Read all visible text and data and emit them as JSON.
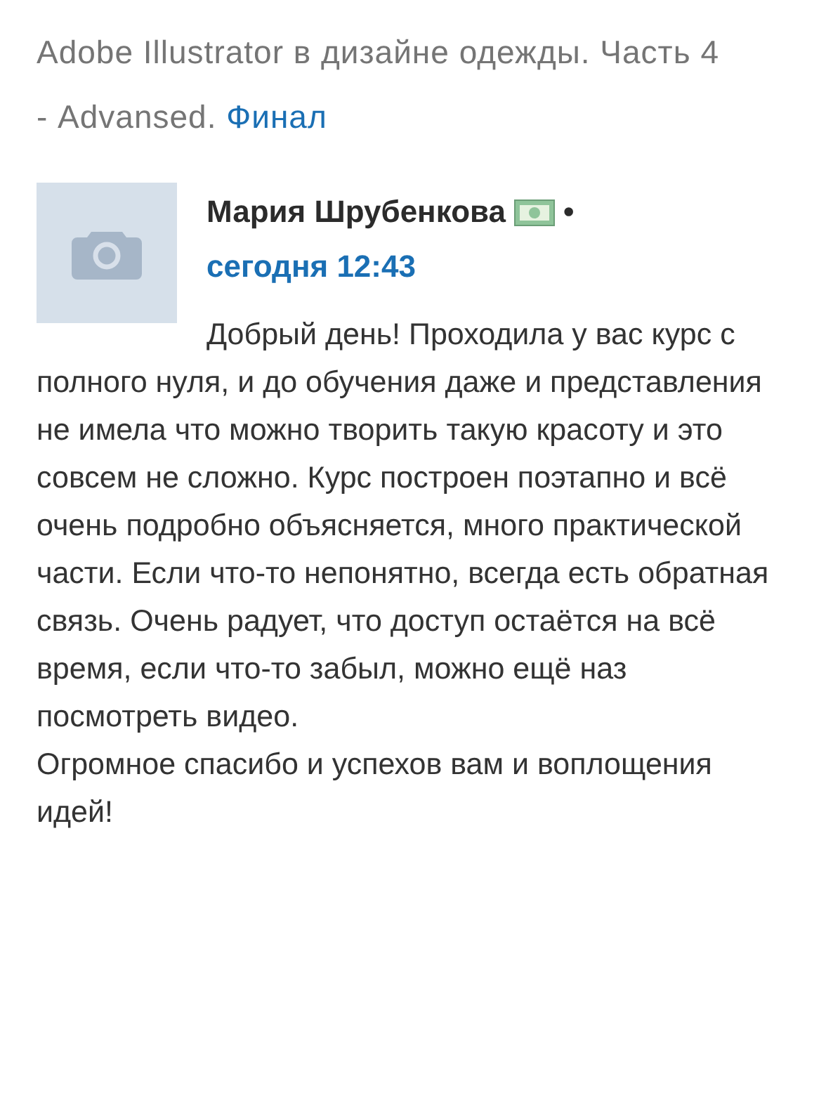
{
  "course_title": {
    "text": "Adobe Illustrator в дизайне одежды. Часть 4 - Advansed.",
    "link": "Финал"
  },
  "review": {
    "author": "Мария Шрубенкова",
    "separator": "•",
    "date": "сегодня 12:43",
    "paragraphs": [
      "Добрый день! Проходила у вас курс с полного нуля, и до обучения даже и представления не имела что можно творить такую красоту и это совсем не сложно. Курс построен поэтапно и всё очень подробно объясняется, много практической части. Если что-то непонятно, всегда есть обратная связь. Очень радует, что доступ остаётся на всё время, если что-то забыл, можно ещё наз посмотреть видео.",
      "Огромное спасибо и успехов вам и воплощения идей!"
    ]
  }
}
